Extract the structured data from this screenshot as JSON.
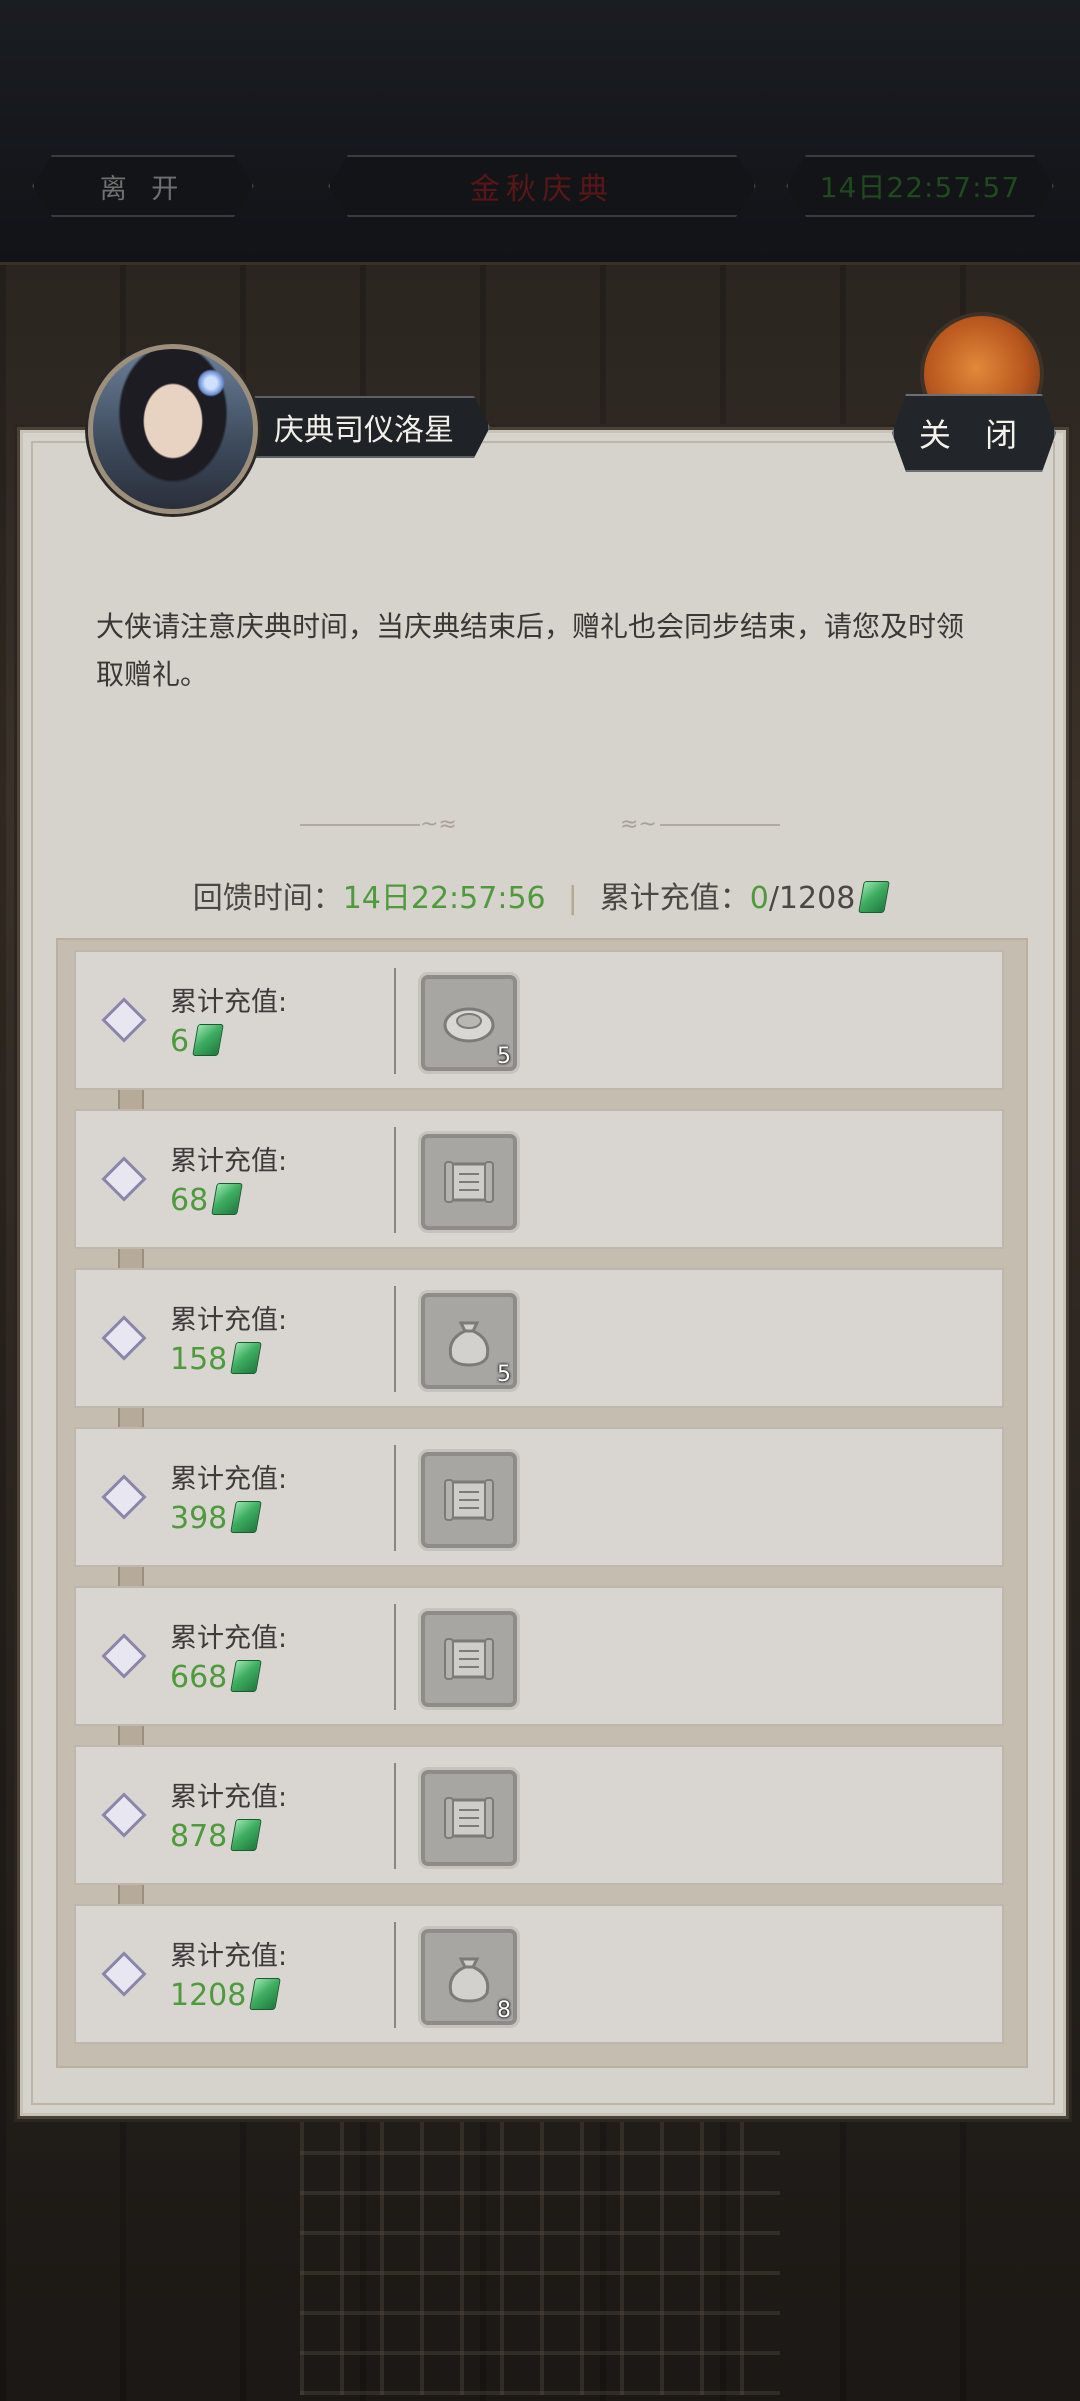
{
  "topbar": {
    "leave_label": "离 开",
    "event_title": "金秋庆典",
    "timer": "14日22:57:57"
  },
  "dialog": {
    "npc_name": "庆典司仪洛星",
    "close_label": "关 闭",
    "notice": "大侠请注意庆典时间，当庆典结束后，赠礼也会同步结束，请您及时领取赠礼。",
    "summary": {
      "time_label": "回馈时间：",
      "time_value": "14日22:57:56",
      "recharge_label": "累计充值：",
      "recharge_current": "0",
      "recharge_target": "/1208"
    }
  },
  "rewards": [
    {
      "label": "累计充值:",
      "amount": "6",
      "item_icon": "coin-icon",
      "count": "5"
    },
    {
      "label": "累计充值:",
      "amount": "68",
      "item_icon": "scroll-icon",
      "count": ""
    },
    {
      "label": "累计充值:",
      "amount": "158",
      "item_icon": "pouch-icon",
      "count": "5"
    },
    {
      "label": "累计充值:",
      "amount": "398",
      "item_icon": "scroll-icon",
      "count": ""
    },
    {
      "label": "累计充值:",
      "amount": "668",
      "item_icon": "scroll-icon",
      "count": ""
    },
    {
      "label": "累计充值:",
      "amount": "878",
      "item_icon": "scroll-icon",
      "count": ""
    },
    {
      "label": "累计充值:",
      "amount": "1208",
      "item_icon": "pouch-icon",
      "count": "8"
    }
  ],
  "colors": {
    "accent_green": "#4e9a3c",
    "panel_bg": "#d6d2cc",
    "row_bg": "#d9d6d2"
  }
}
